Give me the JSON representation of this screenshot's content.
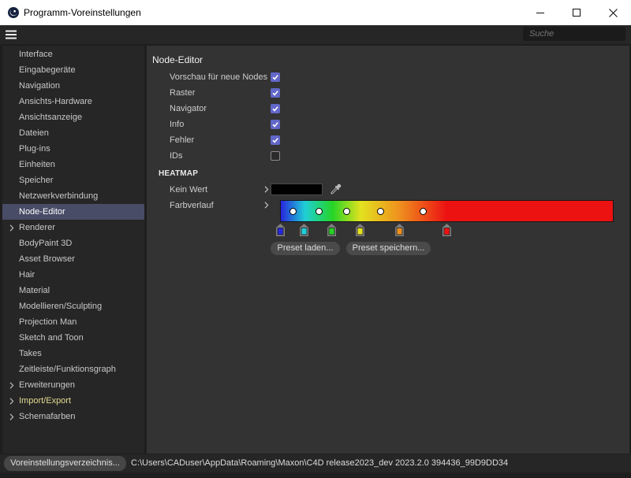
{
  "window": {
    "title": "Programm-Voreinstellungen",
    "app_icon": "cinema4d-logo-icon",
    "controls": [
      "minimize-icon",
      "maximize-icon",
      "close-icon"
    ]
  },
  "toolbar": {
    "menu_icon": "menu-icon",
    "search_placeholder": "Suche"
  },
  "colors": {
    "selected_bg": "#484c67",
    "checkbox_checked": "#6267c8",
    "highlight_text": "#e4db93"
  },
  "sidebar": {
    "items": [
      {
        "label": "Interface"
      },
      {
        "label": "Eingabegeräte"
      },
      {
        "label": "Navigation"
      },
      {
        "label": "Ansichts-Hardware"
      },
      {
        "label": "Ansichtsanzeige"
      },
      {
        "label": "Dateien"
      },
      {
        "label": "Plug-ins"
      },
      {
        "label": "Einheiten"
      },
      {
        "label": "Speicher"
      },
      {
        "label": "Netzwerkverbindung"
      },
      {
        "label": "Node-Editor",
        "selected": true
      },
      {
        "label": "Renderer",
        "expandable": true
      },
      {
        "label": "BodyPaint 3D"
      },
      {
        "label": "Asset Browser"
      },
      {
        "label": "Hair"
      },
      {
        "label": "Material"
      },
      {
        "label": "Modellieren/Sculpting"
      },
      {
        "label": "Projection Man"
      },
      {
        "label": "Sketch and Toon"
      },
      {
        "label": "Takes"
      },
      {
        "label": "Zeitleiste/Funktionsgraph"
      },
      {
        "label": "Erweiterungen",
        "expandable": true
      },
      {
        "label": "Import/Export",
        "expandable": true,
        "highlighted": true
      },
      {
        "label": "Schemafarben",
        "expandable": true
      }
    ]
  },
  "node_editor": {
    "heading": "Node-Editor",
    "options": [
      {
        "label": "Vorschau für neue Nodes",
        "checked": true
      },
      {
        "label": "Raster",
        "checked": true
      },
      {
        "label": "Navigator",
        "checked": true
      },
      {
        "label": "Info",
        "checked": true
      },
      {
        "label": "Fehler",
        "checked": true
      },
      {
        "label": "IDs",
        "checked": false
      }
    ]
  },
  "heatmap": {
    "title": "HEATMAP",
    "no_value_label": "Kein Wert",
    "no_value_color": "#000000",
    "gradient_label": "Farbverlauf",
    "gradient_stops": [
      {
        "color": "#2626dc",
        "position": 0
      },
      {
        "color": "#1fcfd6",
        "position": 7.3
      },
      {
        "color": "#26d426",
        "position": 15.6
      },
      {
        "color": "#e3e21f",
        "position": 24.1
      },
      {
        "color": "#ef8f1e",
        "position": 35.9
      },
      {
        "color": "#ec1212",
        "position": 49.9
      }
    ],
    "preset_load_label": "Preset laden...",
    "preset_save_label": "Preset speichern..."
  },
  "statusbar": {
    "prefs_folder_button": "Voreinstellungsverzeichnis...",
    "path": "C:\\Users\\CADuser\\AppData\\Roaming\\Maxon\\C4D release2023_dev 2023.2.0 394436_99D9DD34"
  }
}
